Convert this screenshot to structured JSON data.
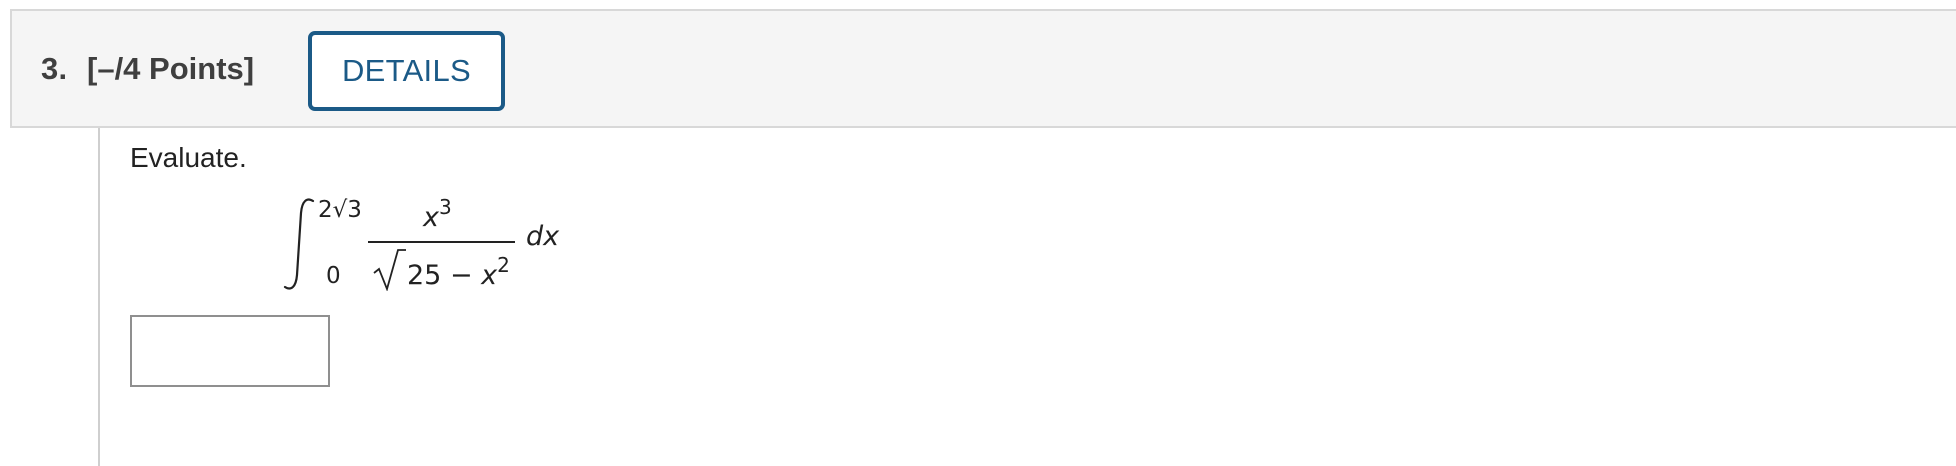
{
  "question": {
    "number": "3.",
    "points": "[–/4 Points]",
    "details_label": "DETAILS",
    "prompt": "Evaluate.",
    "math": {
      "upper_limit": "2√3",
      "lower_limit": "0",
      "numerator_var": "x",
      "numerator_exp": "3",
      "denominator_const": "25 − ",
      "denominator_var": "x",
      "denominator_exp": "2",
      "differential": "dx"
    },
    "answer": {
      "value": "",
      "placeholder": ""
    }
  },
  "colors": {
    "accent": "#1b5a87",
    "header_bg": "#f5f5f5",
    "header_text": "#3f3f3f",
    "input_border": "#8f8f8f"
  },
  "icons": {
    "integral": "integral-sign",
    "radical": "square-root-sign"
  }
}
